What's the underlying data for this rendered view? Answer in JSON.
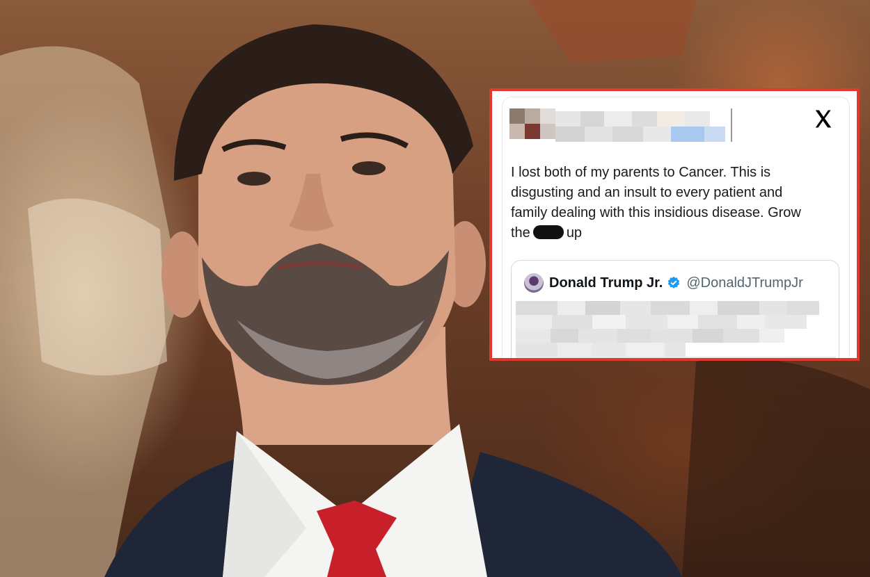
{
  "tweet": {
    "platform_icon": "x-logo-icon",
    "text_lines": [
      "I lost both of my parents to Cancer. This is",
      "disgusting and an insult to every patient and",
      "family dealing with this insidious disease. Grow"
    ],
    "last_line_start": "the",
    "last_line_end": "up",
    "quoted": {
      "name": "Donald Trump Jr.",
      "verified_icon": "verified-badge-icon",
      "handle": "@DonaldJTrumpJr"
    }
  },
  "colors": {
    "frame_border": "#e03a2f",
    "verified_blue": "#1d9bf0",
    "tie_red": "#c8202b",
    "suit_navy": "#1e2638"
  }
}
